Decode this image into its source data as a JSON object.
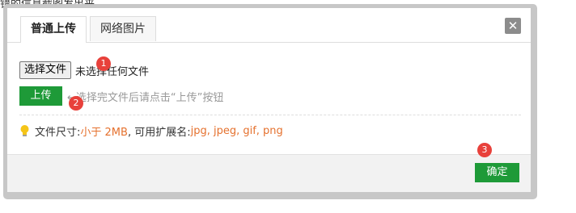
{
  "background": {
    "text": "错的信息截图发出来"
  },
  "tabs": [
    {
      "label": "普通上传",
      "active": true
    },
    {
      "label": "网络图片",
      "active": false
    }
  ],
  "close_button": {
    "glyph": "✕"
  },
  "file_input": {
    "button_label": "选择文件",
    "status": "未选择任何文件"
  },
  "upload": {
    "button_label": "上传",
    "hint": "←选择完文件后请点击“上传”按钮"
  },
  "info": {
    "icon": "lightbulb-icon",
    "size_prefix": "文件尺寸: ",
    "size_value": "小于 2MB",
    "ext_prefix": " , 可用扩展名: ",
    "ext_value": "jpg, jpeg, gif, png"
  },
  "footer": {
    "ok_label": "确定"
  },
  "markers": [
    "1",
    "2",
    "3"
  ],
  "colors": {
    "accent_green": "#1e9a38",
    "highlight_orange": "#e5712e",
    "marker_red": "#e8413b"
  }
}
